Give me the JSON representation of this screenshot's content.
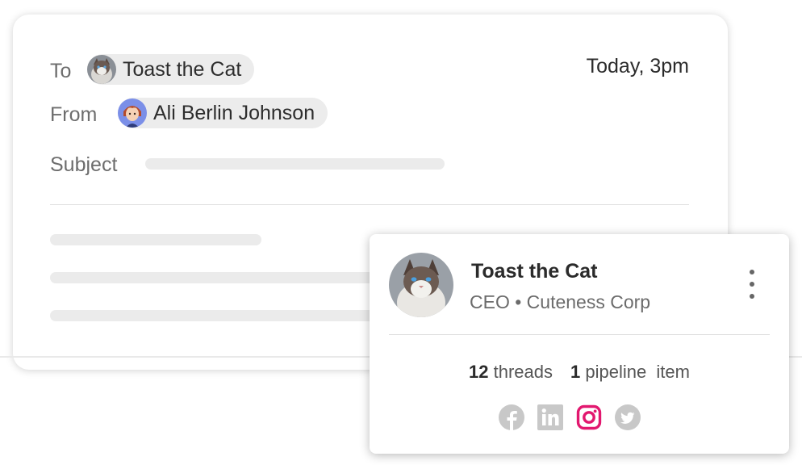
{
  "email": {
    "to_label": "To",
    "to_name": "Toast the Cat",
    "from_label": "From",
    "from_name": "Ali Berlin Johnson",
    "subject_label": "Subject",
    "timestamp": "Today, 3pm"
  },
  "contact": {
    "name": "Toast the Cat",
    "role": "CEO • Cuteness Corp",
    "threads_count": "12",
    "threads_label": "threads",
    "pipeline_count": "1",
    "pipeline_label": "pipeline  item",
    "socials": [
      {
        "icon": "facebook-icon",
        "color": "#c8c8c8"
      },
      {
        "icon": "linkedin-icon",
        "color": "#c8c8c8"
      },
      {
        "icon": "instagram-icon",
        "color": "#e2186f"
      },
      {
        "icon": "twitter-icon",
        "color": "#c8c8c8"
      }
    ]
  },
  "colors": {
    "placeholder": "#ebebeb",
    "chip": "#ececec",
    "instagram_accent": "#e2186f"
  }
}
